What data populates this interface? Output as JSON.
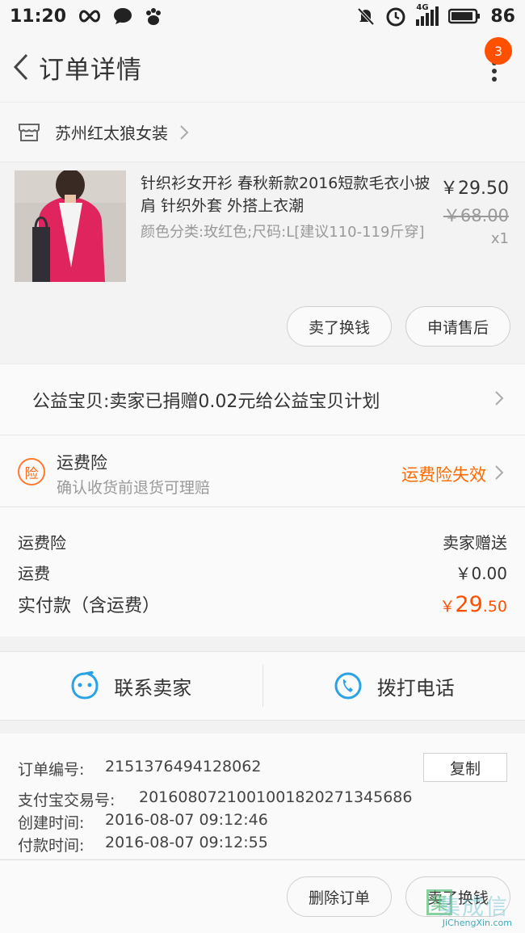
{
  "status_bar": {
    "time": "11:20",
    "network": "4G",
    "battery": "86"
  },
  "header": {
    "title": "订单详情",
    "badge_count": "3"
  },
  "shop": {
    "name": "苏州红太狼女装"
  },
  "item": {
    "title": "针织衫女开衫 春秋新款2016短款毛衣小披肩 针织外套 外搭上衣潮",
    "sku": "颜色分类:玫红色;尺码:L[建议110-119斤穿]",
    "price": "￥29.50",
    "original_price": "￥68.00",
    "quantity": "x1",
    "actions": [
      "卖了换钱",
      "申请售后"
    ]
  },
  "charity": {
    "text": "公益宝贝:卖家已捐赠0.02元给公益宝贝计划"
  },
  "insurance": {
    "title": "运费险",
    "subtitle": "确认收货前退货可理赔",
    "status": "运费险失效",
    "icon_label": "险",
    "accent_color": "#ff6a00"
  },
  "fees": {
    "insurance_label": "运费险",
    "insurance_value": "卖家赠送",
    "shipping_label": "运费",
    "shipping_value": "￥0.00",
    "paid_label": "实付款（含运费）",
    "paid_currency": "￥",
    "paid_integer": "29",
    "paid_decimal": ".50"
  },
  "contact": {
    "seller_label": "联系卖家",
    "phone_label": "拨打电话"
  },
  "order_info": {
    "order_no_label": "订单编号:",
    "order_no": "2151376494128062",
    "copy_label": "复制",
    "alipay_label": "支付宝交易号:",
    "alipay_no": "2016080721001001820271345686",
    "created_label": "创建时间:",
    "created": "2016-08-07 09:12:46",
    "paid_label": "付款时间:",
    "paid": "2016-08-07 09:12:55"
  },
  "bottom_bar": {
    "delete_label": "删除订单",
    "sell_label": "卖了换钱"
  },
  "watermark": {
    "chinese": "集成信",
    "text": "JiChengXin.com"
  }
}
